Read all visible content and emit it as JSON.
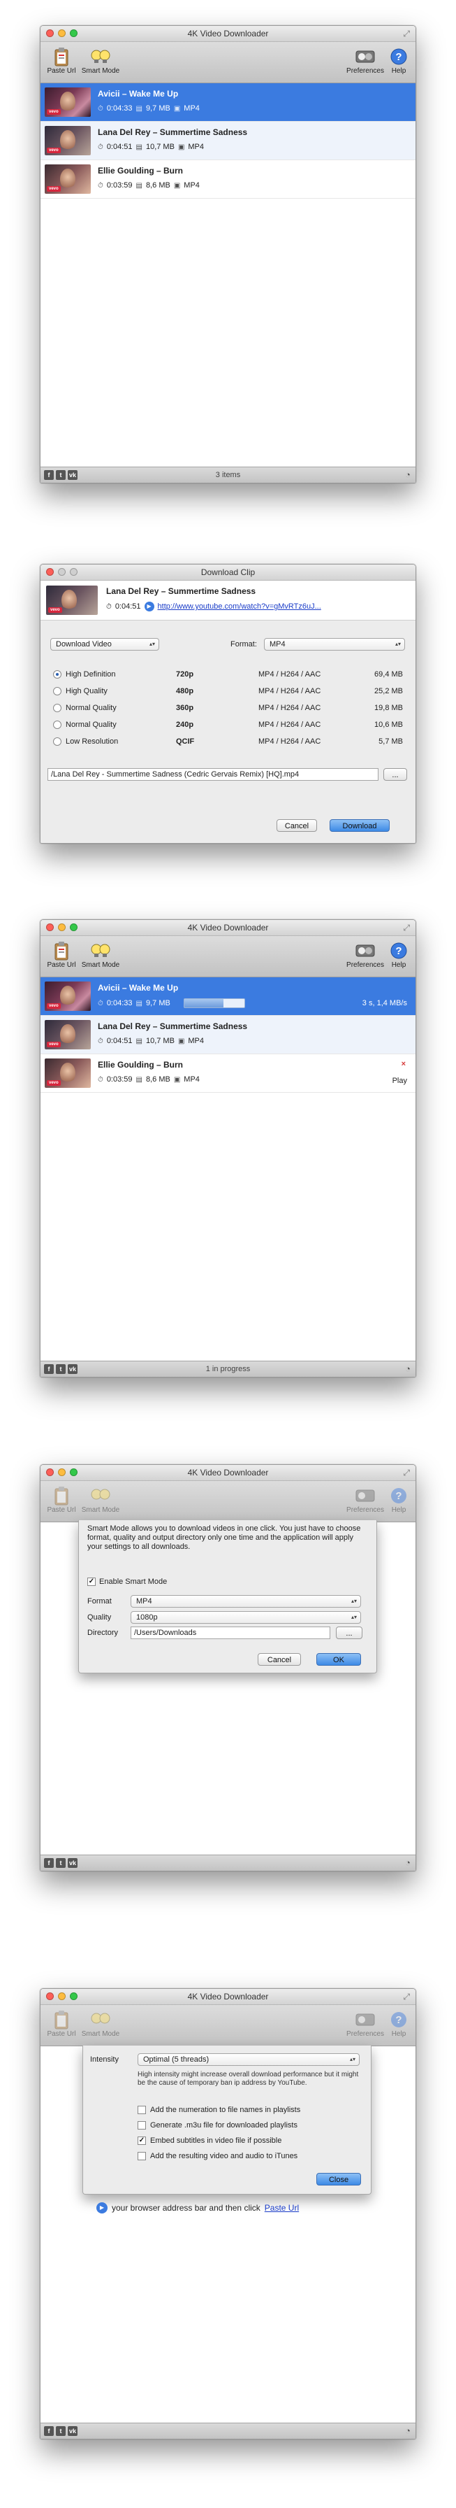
{
  "window1": {
    "title": "4K Video Downloader",
    "toolbar": {
      "paste_url": "Paste Url",
      "smart_mode": "Smart Mode",
      "preferences": "Preferences",
      "help": "Help"
    },
    "rows": [
      {
        "title": "Avicii – Wake Me Up",
        "duration": "0:04:33",
        "size": "9,7 MB",
        "format": "MP4"
      },
      {
        "title": "Lana Del Rey – Summertime Sadness",
        "duration": "0:04:51",
        "size": "10,7 MB",
        "format": "MP4"
      },
      {
        "title": "Ellie Goulding – Burn",
        "duration": "0:03:59",
        "size": "8,6 MB",
        "format": "MP4"
      }
    ],
    "status": "3 items"
  },
  "download_clip": {
    "title": "Download Clip",
    "clip_title": "Lana Del Rey – Summertime Sadness",
    "duration": "0:04:51",
    "url": "http://www.youtube.com/watch?v=gMvRTz6uJ...",
    "type_select": "Download Video",
    "format_label": "Format:",
    "format_value": "MP4",
    "qualities": [
      {
        "name": "High Definition",
        "res": "720p",
        "codec": "MP4 / H264 / AAC",
        "size": "69,4 MB",
        "selected": true
      },
      {
        "name": "High Quality",
        "res": "480p",
        "codec": "MP4 / H264 / AAC",
        "size": "25,2 MB",
        "selected": false
      },
      {
        "name": "Normal Quality",
        "res": "360p",
        "codec": "MP4 / H264 / AAC",
        "size": "19,8 MB",
        "selected": false
      },
      {
        "name": "Normal Quality",
        "res": "240p",
        "codec": "MP4 / H264 / AAC",
        "size": "10,6 MB",
        "selected": false
      },
      {
        "name": "Low Resolution",
        "res": "QCIF",
        "codec": "MP4 / H264 / AAC",
        "size": "5,7 MB",
        "selected": false
      }
    ],
    "path": "/Lana Del Rey - Summertime Sadness (Cedric Gervais Remix) [HQ].mp4",
    "browse": "...",
    "cancel": "Cancel",
    "download": "Download"
  },
  "window2": {
    "title": "4K Video Downloader",
    "toolbar": {
      "paste_url": "Paste Url",
      "smart_mode": "Smart Mode",
      "preferences": "Preferences",
      "help": "Help"
    },
    "rows": [
      {
        "title": "Avicii – Wake Me Up",
        "duration": "0:04:33",
        "size": "9,7 MB",
        "rate": "3 s, 1,4 MB/s",
        "progress": 0.65
      },
      {
        "title": "Lana Del Rey – Summertime Sadness",
        "duration": "0:04:51",
        "size": "10,7 MB",
        "format": "MP4"
      },
      {
        "title": "Ellie Goulding – Burn",
        "duration": "0:03:59",
        "size": "8,6 MB",
        "format": "MP4",
        "close": "×",
        "play": "Play"
      }
    ],
    "status": "1 in progress"
  },
  "window3": {
    "title": "4K Video Downloader",
    "toolbar": {
      "paste_url": "Paste Url",
      "smart_mode": "Smart Mode",
      "preferences": "Preferences",
      "help": "Help"
    },
    "smart": {
      "description": "Smart Mode allows you to download videos in one click. You just have to choose format, quality and output directory only one time and the application will apply your settings to all downloads.",
      "enable": "Enable Smart Mode",
      "format_label": "Format",
      "format_value": "MP4",
      "quality_label": "Quality",
      "quality_value": "1080p",
      "directory_label": "Directory",
      "directory_value": "/Users/Downloads",
      "browse": "...",
      "cancel": "Cancel",
      "ok": "OK"
    }
  },
  "window4": {
    "title": "4K Video Downloader",
    "toolbar": {
      "paste_url": "Paste Url",
      "smart_mode": "Smart Mode",
      "preferences": "Preferences",
      "help": "Help"
    },
    "prefs": {
      "intensity_label": "Intensity",
      "intensity_value": "Optimal (5 threads)",
      "note": "High intensity might increase overall download performance but it might be the cause of temporary ban ip address by YouTube.",
      "options": [
        {
          "label": "Add the numeration to file names in playlists",
          "checked": false
        },
        {
          "label": "Generate .m3u file for downloaded playlists",
          "checked": false
        },
        {
          "label": "Embed subtitles in video file if possible",
          "checked": true
        },
        {
          "label": "Add the resulting video and audio to iTunes",
          "checked": false
        }
      ],
      "close": "Close"
    },
    "hint": "your browser address bar and then click",
    "hint_link": "Paste Url"
  }
}
